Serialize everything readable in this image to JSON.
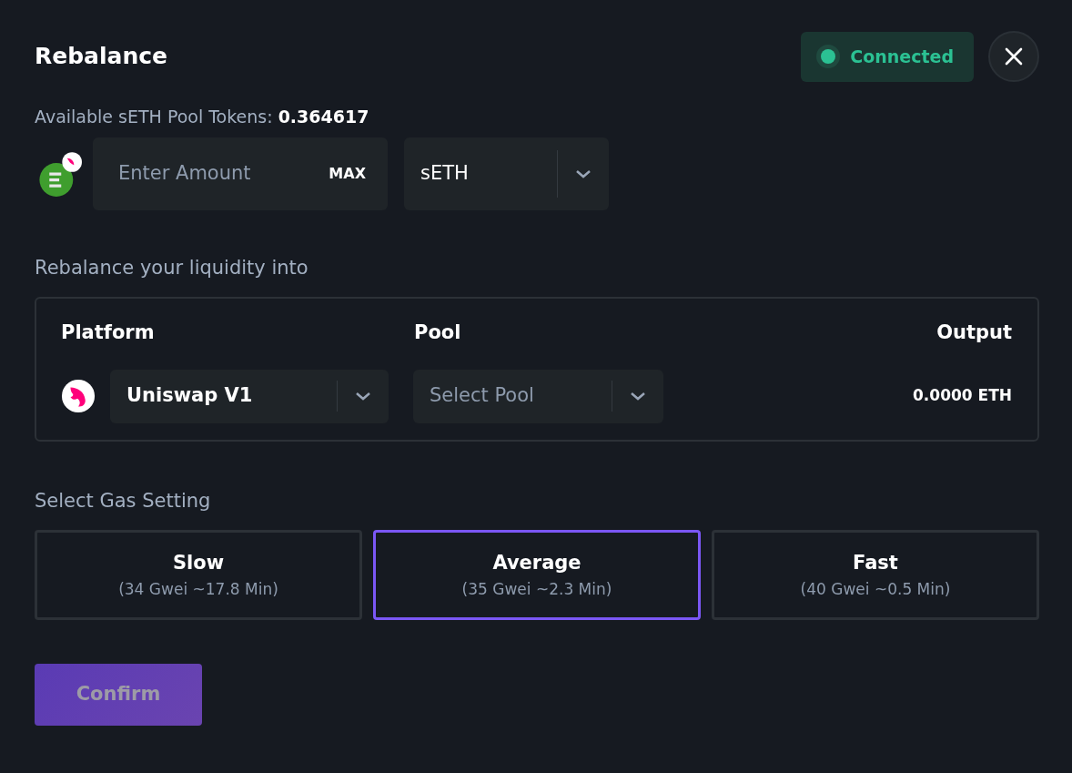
{
  "title": "Rebalance",
  "connection": {
    "label": "Connected",
    "connected": true
  },
  "available": {
    "label": "Available sETH Pool Tokens:",
    "value": "0.364617"
  },
  "amount": {
    "placeholder": "Enter Amount",
    "max_label": "MAX"
  },
  "token_select": {
    "value": "sETH"
  },
  "rebalance_label": "Rebalance your liquidity into",
  "table": {
    "columns": [
      "Platform",
      "Pool",
      "Output"
    ],
    "platform": {
      "value": "Uniswap V1"
    },
    "pool": {
      "placeholder": "Select Pool"
    },
    "output": "0.0000 ETH"
  },
  "gas_label": "Select Gas Setting",
  "gas_options": [
    {
      "label": "Slow",
      "detail": "(34 Gwei ~17.8 Min)",
      "selected": false
    },
    {
      "label": "Average",
      "detail": "(35 Gwei ~2.3 Min)",
      "selected": true
    },
    {
      "label": "Fast",
      "detail": "(40 Gwei ~0.5 Min)",
      "selected": false
    }
  ],
  "confirm": {
    "label": "Confirm",
    "disabled": true
  }
}
